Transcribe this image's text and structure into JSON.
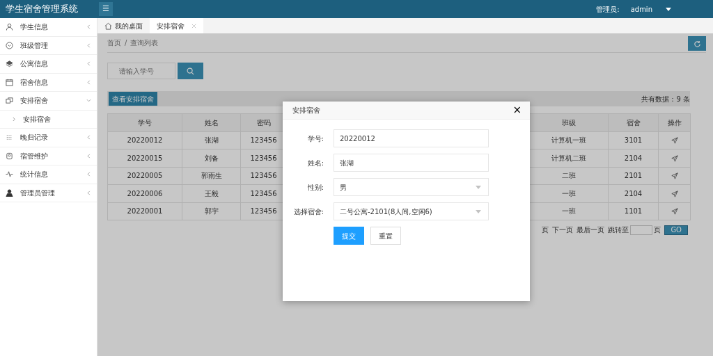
{
  "header": {
    "title": "学生宿舍管理系统",
    "menu_icon": "☰",
    "admin_label": "管理员:",
    "admin_name": "admin"
  },
  "sidebar": {
    "items": [
      {
        "label": "学生信息",
        "expanded": false
      },
      {
        "label": "班级管理",
        "expanded": false
      },
      {
        "label": "公寓信息",
        "expanded": false
      },
      {
        "label": "宿舍信息",
        "expanded": false
      },
      {
        "label": "安排宿舍",
        "expanded": true,
        "children": [
          {
            "label": "安排宿舍"
          }
        ]
      },
      {
        "label": "晚归记录",
        "expanded": false
      },
      {
        "label": "宿管维护",
        "expanded": false
      },
      {
        "label": "统计信息",
        "expanded": false
      },
      {
        "label": "管理员管理",
        "expanded": false
      }
    ]
  },
  "tabs": [
    {
      "label": "我的桌面",
      "selected": false,
      "kind": "home"
    },
    {
      "label": "安排宿舍",
      "selected": true,
      "kind": "closable"
    }
  ],
  "breadcrumb": {
    "items": [
      "首页",
      "查询列表"
    ],
    "separator": "/"
  },
  "search": {
    "placeholder": "请输入学号"
  },
  "toolbar": {
    "button": "查看安排宿舍",
    "total": "共有数据：9 条"
  },
  "table": {
    "columns": [
      "学号",
      "姓名",
      "密码",
      "",
      "班级",
      "宿舍",
      "操作"
    ],
    "rows": [
      [
        "20220012",
        "张湖",
        "123456",
        "",
        "计算机一班",
        "3101"
      ],
      [
        "20220015",
        "刘备",
        "123456",
        "",
        "计算机二班",
        "2104"
      ],
      [
        "20220005",
        "郭雨生",
        "123456",
        "",
        "二班",
        "2101"
      ],
      [
        "20220006",
        "王毅",
        "123456",
        "",
        "一班",
        "2104"
      ],
      [
        "20220001",
        "郭宇",
        "123456",
        "",
        "一班",
        "1101"
      ]
    ]
  },
  "pagination": {
    "items": [
      "页",
      "下一页",
      "最后一页"
    ],
    "jump_label": "跳转至",
    "page_unit": "页",
    "go": "GO"
  },
  "modal": {
    "title": "安排宿舍",
    "close": "×",
    "fields": [
      {
        "label": "学号:",
        "value": "20220012",
        "kind": "input"
      },
      {
        "label": "姓名:",
        "value": "张湖",
        "kind": "input"
      },
      {
        "label": "性别:",
        "value": "男",
        "kind": "select"
      },
      {
        "label": "选择宿舍:",
        "value": "二号公寓-2101(8人间,空闲6)",
        "kind": "select"
      }
    ],
    "buttons": [
      {
        "label": "提交",
        "kind": "primary"
      },
      {
        "label": "重置",
        "kind": "default"
      }
    ]
  }
}
